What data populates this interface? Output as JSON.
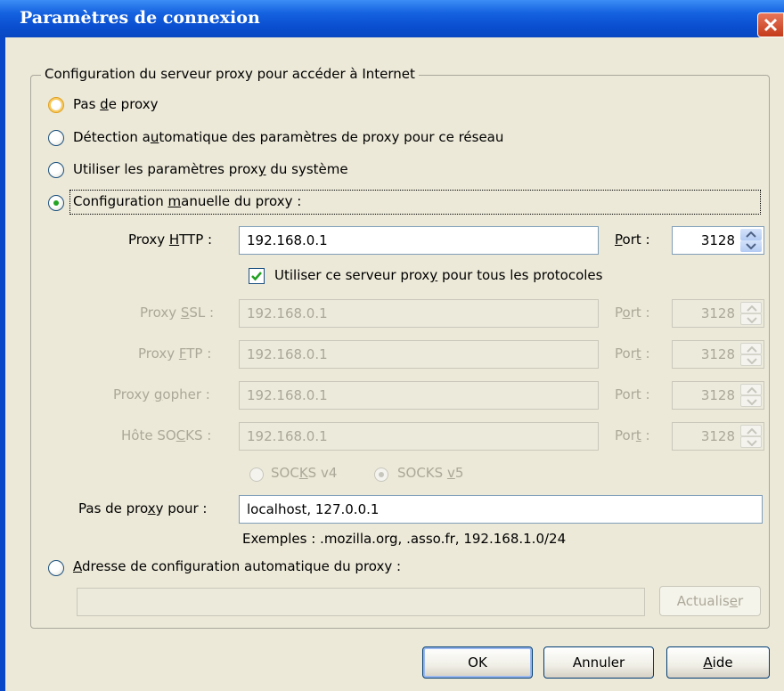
{
  "window": {
    "title": "Paramètres de connexion"
  },
  "group": {
    "legend": "Configuration du serveur proxy pour accéder à Internet"
  },
  "radios": {
    "no_proxy": {
      "pre": "Pas ",
      "acc": "d",
      "post": "e proxy"
    },
    "auto_detect": {
      "pre": "Détection a",
      "acc": "u",
      "post": "tomatique des paramètres de proxy pour ce réseau"
    },
    "system": {
      "pre": "Utiliser les paramètres prox",
      "acc": "y",
      "post": " du système"
    },
    "manual": {
      "pre": "Configuration ",
      "acc": "m",
      "post": "anuelle du proxy :"
    },
    "auto_config": {
      "pre": "",
      "acc": "A",
      "post": "dresse de configuration automatique du proxy :"
    }
  },
  "http": {
    "pre": "Proxy ",
    "acc": "H",
    "post": "TTP :",
    "value": "192.168.0.1",
    "port_acc": "P",
    "port_post": "ort :",
    "port": "3128"
  },
  "share": {
    "pre": "Utiliser ce serveur prox",
    "acc": "y",
    "post": " pour tous les protocoles"
  },
  "ssl": {
    "pre": "Proxy ",
    "acc": "S",
    "post": "SL :",
    "value": "192.168.0.1",
    "port_pre": "P",
    "port_acc": "o",
    "port_post": "rt :",
    "port": "3128"
  },
  "ftp": {
    "pre": "Proxy ",
    "acc": "F",
    "post": "TP :",
    "value": "192.168.0.1",
    "port_pre": "Por",
    "port_acc": "t",
    "port_post": " :",
    "port": "3128"
  },
  "gopher": {
    "pre": "Proxy ",
    "acc": "g",
    "post": "opher :",
    "value": "192.168.0.1",
    "port_label": "Port :",
    "port": "3128"
  },
  "socks": {
    "pre": "Hôte SO",
    "acc": "C",
    "post": "KS :",
    "value": "192.168.0.1",
    "port_pre": "Por",
    "port_acc": "t",
    "port_post": " :",
    "port": "3128"
  },
  "socks_v4": {
    "pre": "SOC",
    "acc": "K",
    "post": "S v4"
  },
  "socks_v5": {
    "pre": "SOCKS ",
    "acc": "v",
    "post": "5"
  },
  "no_proxy_for": {
    "pre": "Pas de pro",
    "acc": "x",
    "post": "y pour :",
    "value": "localhost, 127.0.0.1"
  },
  "examples": "Exemples : .mozilla.org, .asso.fr, 192.168.1.0/24",
  "auto_url": {
    "value": ""
  },
  "reload": {
    "pre": "Actualis",
    "acc": "e",
    "post": "r"
  },
  "buttons": {
    "ok": "OK",
    "cancel": "Annuler",
    "help_acc": "A",
    "help_post": "ide"
  }
}
